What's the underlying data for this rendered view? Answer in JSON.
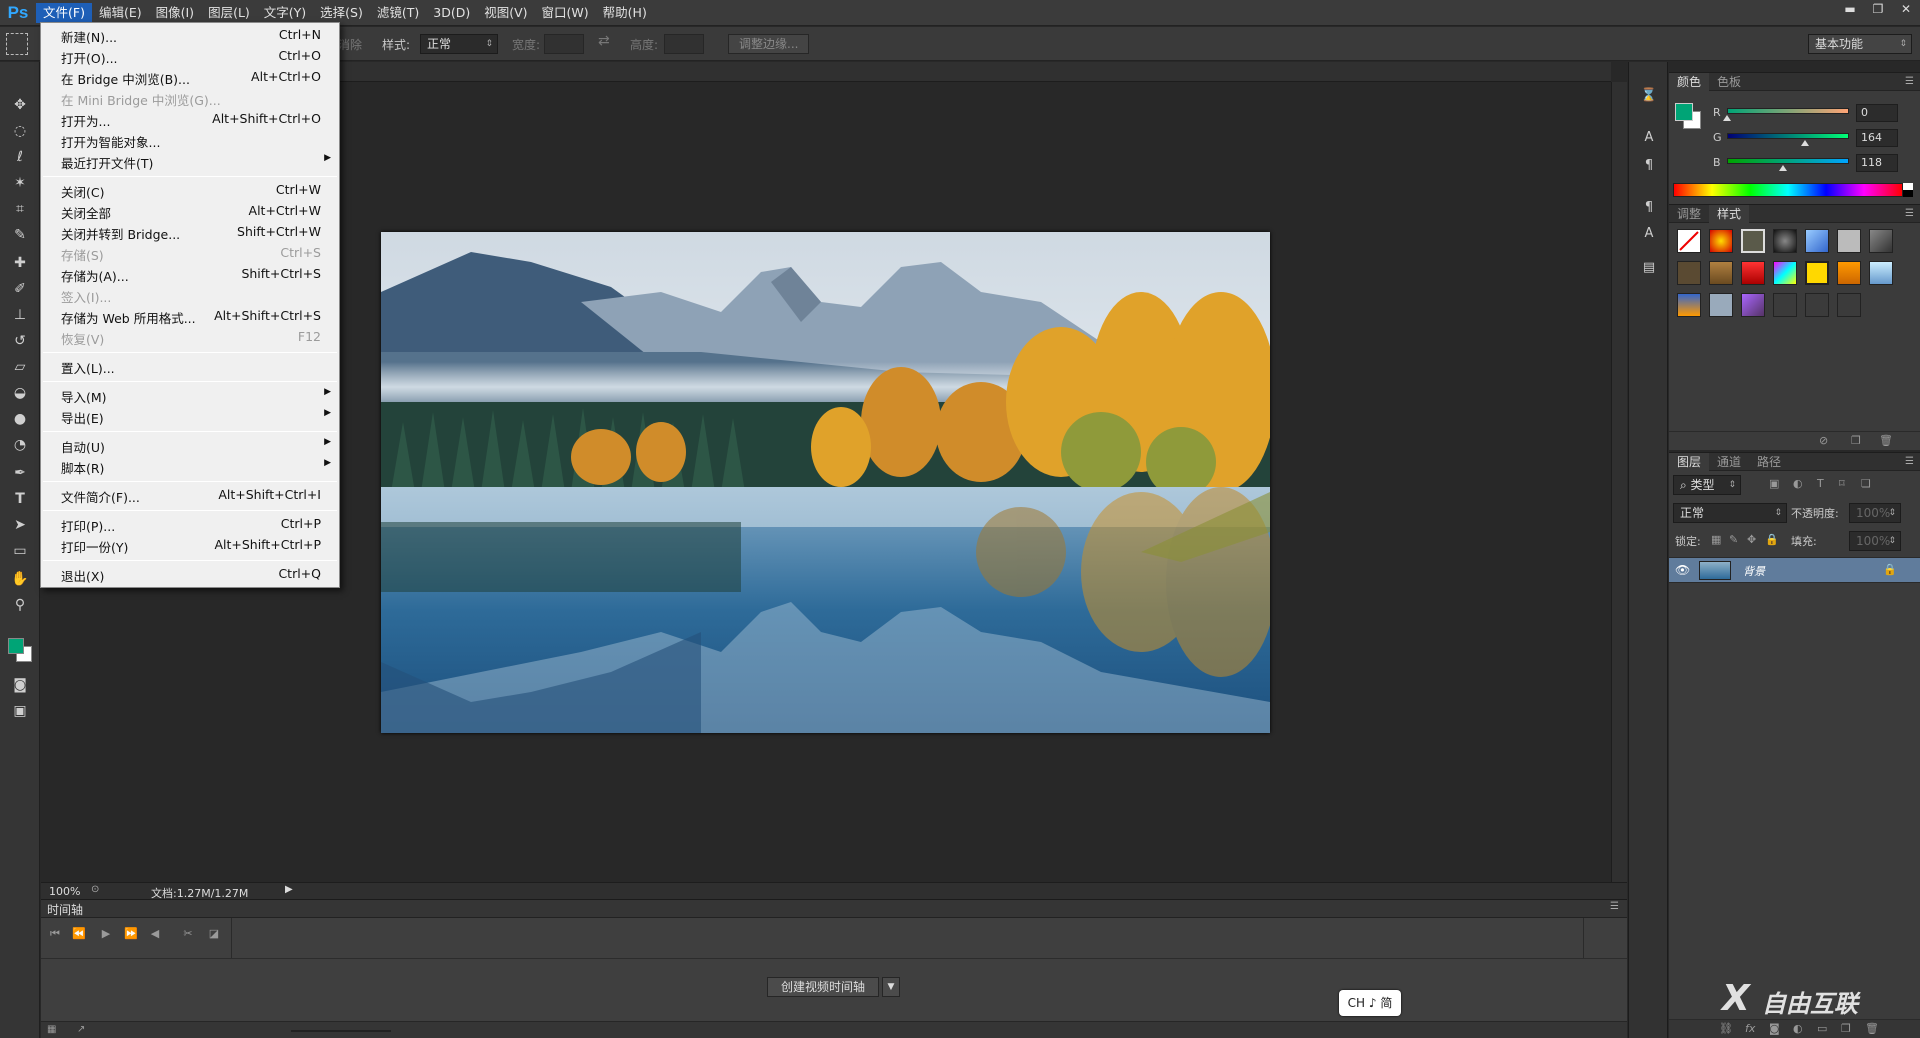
{
  "app": {
    "logo": "Ps"
  },
  "menubar": {
    "items": [
      "文件(F)",
      "编辑(E)",
      "图像(I)",
      "图层(L)",
      "文字(Y)",
      "选择(S)",
      "滤镜(T)",
      "3D(D)",
      "视图(V)",
      "窗口(W)",
      "帮助(H)"
    ],
    "active_index": 0
  },
  "window_controls": {
    "minimize": "▬",
    "restore": "❐",
    "close": "✕"
  },
  "options_bar": {
    "partial_label": "消除",
    "style_label": "样式:",
    "style_value": "正常",
    "width_label": "宽度:",
    "height_label": "高度:",
    "refine_edge_button": "调整边缘...",
    "workspace": "基本功能"
  },
  "file_menu": {
    "items": [
      {
        "label": "新建(N)...",
        "shortcut": "Ctrl+N",
        "disabled": false,
        "submenu": false
      },
      {
        "label": "打开(O)...",
        "shortcut": "Ctrl+O",
        "disabled": false,
        "submenu": false
      },
      {
        "label": "在 Bridge 中浏览(B)...",
        "shortcut": "Alt+Ctrl+O",
        "disabled": false,
        "submenu": false
      },
      {
        "label": "在 Mini Bridge 中浏览(G)...",
        "shortcut": "",
        "disabled": true,
        "submenu": false
      },
      {
        "label": "打开为...",
        "shortcut": "Alt+Shift+Ctrl+O",
        "disabled": false,
        "submenu": false
      },
      {
        "label": "打开为智能对象...",
        "shortcut": "",
        "disabled": false,
        "submenu": false
      },
      {
        "label": "最近打开文件(T)",
        "shortcut": "",
        "disabled": false,
        "submenu": true
      },
      {
        "label": "关闭(C)",
        "shortcut": "Ctrl+W",
        "disabled": false,
        "submenu": false
      },
      {
        "label": "关闭全部",
        "shortcut": "Alt+Ctrl+W",
        "disabled": false,
        "submenu": false
      },
      {
        "label": "关闭并转到 Bridge...",
        "shortcut": "Shift+Ctrl+W",
        "disabled": false,
        "submenu": false
      },
      {
        "label": "存储(S)",
        "shortcut": "Ctrl+S",
        "disabled": true,
        "submenu": false
      },
      {
        "label": "存储为(A)...",
        "shortcut": "Shift+Ctrl+S",
        "disabled": false,
        "submenu": false
      },
      {
        "label": "签入(I)...",
        "shortcut": "",
        "disabled": true,
        "submenu": false
      },
      {
        "label": "存储为 Web 所用格式...",
        "shortcut": "Alt+Shift+Ctrl+S",
        "disabled": false,
        "submenu": false
      },
      {
        "label": "恢复(V)",
        "shortcut": "F12",
        "disabled": true,
        "submenu": false
      },
      {
        "label": "置入(L)...",
        "shortcut": "",
        "disabled": false,
        "submenu": false
      },
      {
        "label": "导入(M)",
        "shortcut": "",
        "disabled": false,
        "submenu": true
      },
      {
        "label": "导出(E)",
        "shortcut": "",
        "disabled": false,
        "submenu": true
      },
      {
        "label": "自动(U)",
        "shortcut": "",
        "disabled": false,
        "submenu": true
      },
      {
        "label": "脚本(R)",
        "shortcut": "",
        "disabled": false,
        "submenu": true
      },
      {
        "label": "文件简介(F)...",
        "shortcut": "Alt+Shift+Ctrl+I",
        "disabled": false,
        "submenu": false
      },
      {
        "label": "打印(P)...",
        "shortcut": "Ctrl+P",
        "disabled": false,
        "submenu": false
      },
      {
        "label": "打印一份(Y)",
        "shortcut": "Alt+Shift+Ctrl+P",
        "disabled": false,
        "submenu": false
      },
      {
        "label": "退出(X)",
        "shortcut": "Ctrl+Q",
        "disabled": false,
        "submenu": false
      }
    ]
  },
  "status_bar": {
    "zoom": "100%",
    "doc_info": "文档:1.27M/1.27M"
  },
  "timeline": {
    "title": "时间轴",
    "create_button": "创建视频时间轴"
  },
  "ime": {
    "text": "CH ♪ 简"
  },
  "color_panel": {
    "tabs": [
      "颜色",
      "色板"
    ],
    "foreground": "#00a476",
    "channels": [
      {
        "name": "R",
        "value": "0",
        "fraction": 0.0
      },
      {
        "name": "G",
        "value": "164",
        "fraction": 0.643
      },
      {
        "name": "B",
        "value": "118",
        "fraction": 0.463
      }
    ]
  },
  "styles_panel": {
    "tabs": [
      "调整",
      "样式"
    ]
  },
  "layers_panel": {
    "tabs": [
      "图层",
      "通道",
      "路径"
    ],
    "filter_kind": "类型",
    "blend_mode": "正常",
    "opacity_label": "不透明度:",
    "opacity_value": "100%",
    "lock_label": "锁定:",
    "fill_label": "填充:",
    "fill_value": "100%",
    "layer_name": "背景"
  },
  "watermark": {
    "text": "自由互联"
  },
  "colors": {
    "menu_active": "#1e5fb7",
    "layer_selected": "#607c9c",
    "foreground_swatch": "#00a476",
    "background_swatch": "#ffffff"
  }
}
